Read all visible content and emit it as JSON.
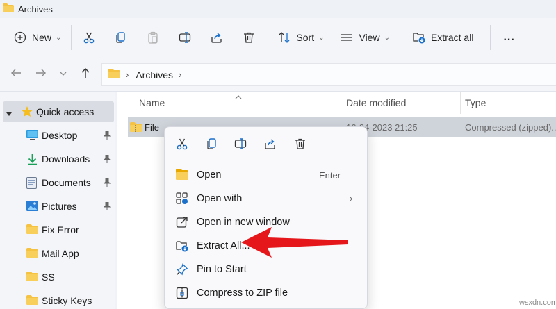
{
  "window": {
    "title": "Archives"
  },
  "toolbar": {
    "new_label": "New",
    "sort_label": "Sort",
    "view_label": "View",
    "extract_all_label": "Extract all",
    "more_label": "..."
  },
  "address": {
    "crumb": "Archives"
  },
  "sidebar": {
    "items": [
      {
        "label": "Quick access",
        "icon": "star-icon"
      },
      {
        "label": "Desktop",
        "icon": "desktop-icon",
        "pinned": true
      },
      {
        "label": "Downloads",
        "icon": "download-icon",
        "pinned": true
      },
      {
        "label": "Documents",
        "icon": "document-icon",
        "pinned": true
      },
      {
        "label": "Pictures",
        "icon": "picture-icon",
        "pinned": true
      },
      {
        "label": "Fix Error",
        "icon": "folder-icon"
      },
      {
        "label": "Mail App",
        "icon": "folder-icon"
      },
      {
        "label": "SS",
        "icon": "folder-icon"
      },
      {
        "label": "Sticky Keys",
        "icon": "folder-icon"
      }
    ]
  },
  "columns": {
    "name": "Name",
    "date": "Date modified",
    "type": "Type"
  },
  "file": {
    "name": "File",
    "date": "16-04-2023 21:25",
    "type": "Compressed (zipped)..."
  },
  "context_menu": {
    "items": [
      {
        "label": "Open",
        "accel": "Enter",
        "icon": "folder-open-icon"
      },
      {
        "label": "Open with",
        "icon": "open-with-icon"
      },
      {
        "label": "Open in new window",
        "icon": "new-window-icon"
      },
      {
        "label": "Extract All...",
        "icon": "extract-icon"
      },
      {
        "label": "Pin to Start",
        "icon": "pin-icon"
      },
      {
        "label": "Compress to ZIP file",
        "icon": "zip-icon"
      }
    ]
  },
  "colors": {
    "accent": "#1a6fc9",
    "folder": "#f5c242",
    "arrow": "#e5171a"
  },
  "watermark": "wsxdn.com"
}
